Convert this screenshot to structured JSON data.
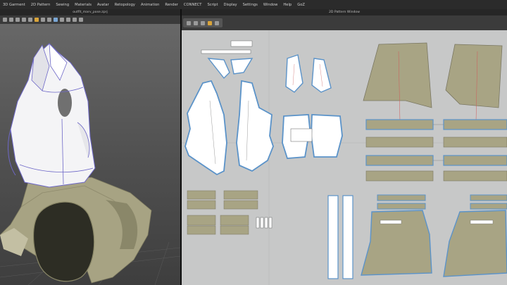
{
  "menubar": {
    "items": [
      "3D Garment",
      "2D Pattern",
      "Sewing",
      "Materials",
      "Avatar",
      "Retopology",
      "Animation",
      "Render",
      "CONNECT",
      "Script",
      "Display",
      "Settings",
      "Window",
      "Help",
      "GoZ"
    ]
  },
  "viewport3d": {
    "title": "outfit_marv_pose.zprj"
  },
  "pattern2d": {
    "title": "2D Pattern Window"
  },
  "colors": {
    "olive_fabric": "#a8a484",
    "white_fabric": "#ffffff",
    "selected_outline": "#5b93c9",
    "canvas": "#c7c8c8"
  }
}
